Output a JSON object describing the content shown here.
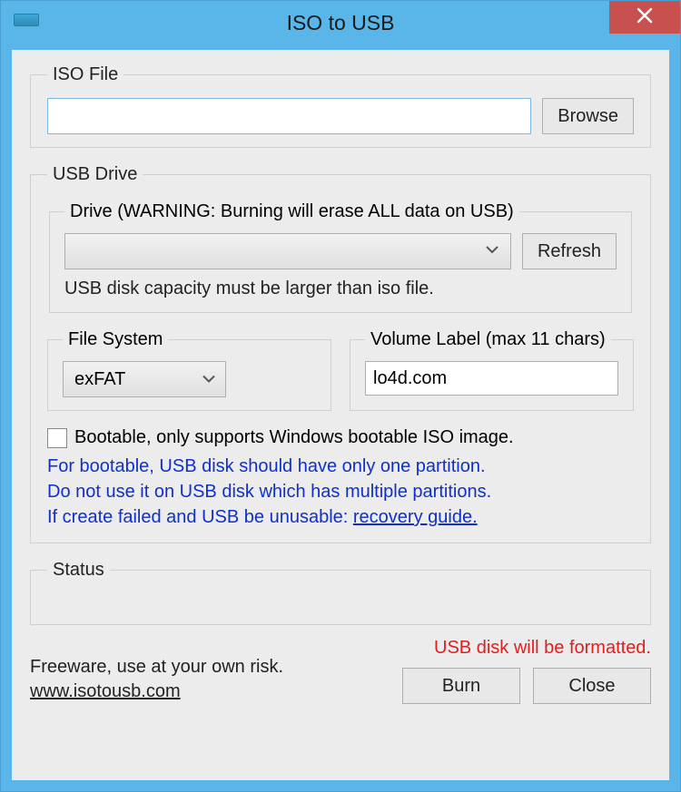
{
  "window": {
    "title": "ISO to USB"
  },
  "iso": {
    "legend": "ISO File",
    "path": "",
    "browse": "Browse"
  },
  "usb": {
    "legend": "USB Drive",
    "drive_legend": "Drive (WARNING: Burning will erase ALL data on USB)",
    "drive_selected": "",
    "refresh": "Refresh",
    "capacity_note": "USB disk capacity must be larger than iso file.",
    "fs_legend": "File System",
    "fs_value": "exFAT",
    "vol_legend": "Volume Label (max 11 chars)",
    "vol_value": "lo4d.com",
    "bootable_checked": false,
    "bootable_label": "Bootable, only supports Windows bootable ISO image.",
    "hint_line1": "For bootable, USB disk should have only one partition.",
    "hint_line2": "Do not use it on USB disk which has multiple partitions.",
    "hint_line3_prefix": "If create failed and USB be unusable: ",
    "hint_link": "recovery guide."
  },
  "status": {
    "legend": "Status",
    "text": ""
  },
  "footer": {
    "freeware": "Freeware, use at your own risk.",
    "site": "www.isotousb.com",
    "format_warning": "USB disk will be formatted.",
    "burn": "Burn",
    "close": "Close"
  }
}
